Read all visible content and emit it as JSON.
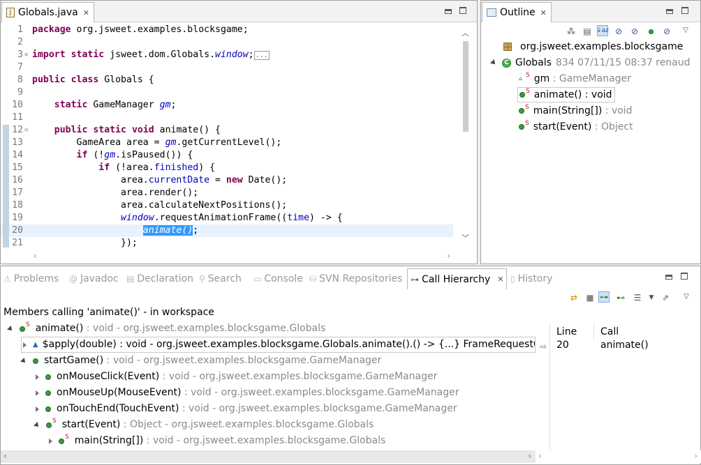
{
  "editor": {
    "tab_label": "Globals.java",
    "tab_icon": "java-file-icon",
    "lines": [
      {
        "n": "1",
        "html_parts": [
          [
            "kw",
            "package"
          ],
          [
            "t",
            " org.jsweet.examples.blocksgame;"
          ]
        ]
      },
      {
        "n": "2",
        "html_parts": [
          [
            "t",
            ""
          ]
        ]
      },
      {
        "n": "3",
        "fold": "plus",
        "html_parts": [
          [
            "kw",
            "import"
          ],
          [
            "t",
            " "
          ],
          [
            "kw",
            "static"
          ],
          [
            "t",
            " jsweet.dom.Globals."
          ],
          [
            "fi",
            "window"
          ],
          [
            "t",
            ";"
          ],
          [
            "col",
            "..."
          ]
        ]
      },
      {
        "n": "7",
        "html_parts": [
          [
            "t",
            ""
          ]
        ]
      },
      {
        "n": "8",
        "html_parts": [
          [
            "kw",
            "public"
          ],
          [
            "t",
            " "
          ],
          [
            "kw",
            "class"
          ],
          [
            "t",
            " Globals {"
          ]
        ]
      },
      {
        "n": "9",
        "html_parts": [
          [
            "t",
            ""
          ]
        ]
      },
      {
        "n": "10",
        "html_parts": [
          [
            "t",
            "    "
          ],
          [
            "kw",
            "static"
          ],
          [
            "t",
            " GameManager "
          ],
          [
            "fi",
            "gm"
          ],
          [
            "t",
            ";"
          ]
        ]
      },
      {
        "n": "11",
        "html_parts": [
          [
            "t",
            ""
          ]
        ]
      },
      {
        "n": "12",
        "fold": "minus",
        "html_parts": [
          [
            "t",
            "    "
          ],
          [
            "kw",
            "public"
          ],
          [
            "t",
            " "
          ],
          [
            "kw",
            "static"
          ],
          [
            "t",
            " "
          ],
          [
            "kw",
            "void"
          ],
          [
            "t",
            " animate() {"
          ]
        ]
      },
      {
        "n": "13",
        "html_parts": [
          [
            "t",
            "        GameArea area = "
          ],
          [
            "fi",
            "gm"
          ],
          [
            "t",
            ".getCurrentLevel();"
          ]
        ]
      },
      {
        "n": "14",
        "html_parts": [
          [
            "t",
            "        "
          ],
          [
            "kw",
            "if"
          ],
          [
            "t",
            " (!"
          ],
          [
            "fi",
            "gm"
          ],
          [
            "t",
            ".isPaused()) {"
          ]
        ]
      },
      {
        "n": "15",
        "html_parts": [
          [
            "t",
            "            "
          ],
          [
            "kw",
            "if"
          ],
          [
            "t",
            " (!area."
          ],
          [
            "f",
            "finished"
          ],
          [
            "t",
            ") {"
          ]
        ]
      },
      {
        "n": "16",
        "html_parts": [
          [
            "t",
            "                area."
          ],
          [
            "f",
            "currentDate"
          ],
          [
            "t",
            " = "
          ],
          [
            "kw",
            "new"
          ],
          [
            "t",
            " Date();"
          ]
        ]
      },
      {
        "n": "17",
        "html_parts": [
          [
            "t",
            "                area.render();"
          ]
        ]
      },
      {
        "n": "18",
        "html_parts": [
          [
            "t",
            "                area.calculateNextPositions();"
          ]
        ]
      },
      {
        "n": "19",
        "html_parts": [
          [
            "t",
            "                "
          ],
          [
            "fi",
            "window"
          ],
          [
            "t",
            ".requestAnimationFrame(("
          ],
          [
            "f",
            "time"
          ],
          [
            "t",
            ") -> {"
          ]
        ]
      },
      {
        "n": "20",
        "current": true,
        "html_parts": [
          [
            "t",
            "                    "
          ],
          [
            "sel",
            "animate()"
          ],
          [
            "t",
            ";"
          ]
        ]
      },
      {
        "n": "21",
        "html_parts": [
          [
            "t",
            "                });"
          ]
        ]
      }
    ]
  },
  "outline": {
    "tab_label": "Outline",
    "package": "org.jsweet.examples.blocksgame",
    "class_name": "Globals",
    "class_meta": "834  07/11/15 08:37  renaud",
    "members": [
      {
        "name": "gm",
        "type": " : GameManager",
        "kind": "field",
        "selected": false
      },
      {
        "name": "animate()",
        "type": " : void",
        "kind": "method",
        "selected": true
      },
      {
        "name": "main(String[])",
        "type": " : void",
        "kind": "method",
        "selected": false
      },
      {
        "name": "start(Event)",
        "type": " : Object",
        "kind": "method",
        "selected": false
      }
    ],
    "toolbar_icons": [
      "collapse-all-icon",
      "focus-icon",
      "sort-alpha-icon",
      "hide-fields-icon",
      "hide-static-icon",
      "hide-nonpublic-icon",
      "hide-local-types-icon",
      "view-menu-icon"
    ]
  },
  "bottom": {
    "tabs": [
      {
        "label": "Problems",
        "icon": "problems-icon"
      },
      {
        "label": "Javadoc",
        "icon": "at-icon"
      },
      {
        "label": "Declaration",
        "icon": "declaration-icon"
      },
      {
        "label": "Search",
        "icon": "search-icon"
      },
      {
        "label": "Console",
        "icon": "console-icon"
      },
      {
        "label": "SVN Repositories",
        "icon": "svn-icon"
      },
      {
        "label": "Call Hierarchy",
        "icon": "call-hierarchy-icon",
        "active": true
      },
      {
        "label": "History",
        "icon": "history-icon"
      }
    ],
    "header": "Members calling 'animate()' - in workspace",
    "table_columns": [
      "Line",
      "Call"
    ],
    "table_rows": [
      {
        "line": "20",
        "call": "animate()"
      }
    ],
    "tree": [
      {
        "indent": 0,
        "expander": "down",
        "icon": "static-method",
        "name": "animate()",
        "rest": " : void - org.jsweet.examples.blocksgame.Globals"
      },
      {
        "indent": 1,
        "expander": "right",
        "icon": "lambda",
        "name": "$apply(double) : void - org.jsweet.examples.blocksgame.Globals.animate().() -> {...} FrameRequestCallback",
        "rest": "",
        "selected": true,
        "black": true
      },
      {
        "indent": 1,
        "expander": "down",
        "icon": "method",
        "name": "startGame()",
        "rest": " : void - org.jsweet.examples.blocksgame.GameManager"
      },
      {
        "indent": 2,
        "expander": "right",
        "icon": "method",
        "name": "onMouseClick(Event)",
        "rest": " : void - org.jsweet.examples.blocksgame.GameManager"
      },
      {
        "indent": 2,
        "expander": "right",
        "icon": "method",
        "name": "onMouseUp(MouseEvent)",
        "rest": " : void - org.jsweet.examples.blocksgame.GameManager"
      },
      {
        "indent": 2,
        "expander": "right",
        "icon": "method",
        "name": "onTouchEnd(TouchEvent)",
        "rest": " : void - org.jsweet.examples.blocksgame.GameManager"
      },
      {
        "indent": 2,
        "expander": "down",
        "icon": "static-method",
        "name": "start(Event)",
        "rest": " : Object - org.jsweet.examples.blocksgame.Globals"
      },
      {
        "indent": 3,
        "expander": "right",
        "icon": "static-method",
        "name": "main(String[])",
        "rest": " : void - org.jsweet.examples.blocksgame.Globals"
      }
    ]
  },
  "colors": {
    "keyword": "#7f0055",
    "field": "#0000c0",
    "selection": "#3399ff",
    "current_line": "#e8f2fe",
    "method_green": "#3a9a3a"
  }
}
